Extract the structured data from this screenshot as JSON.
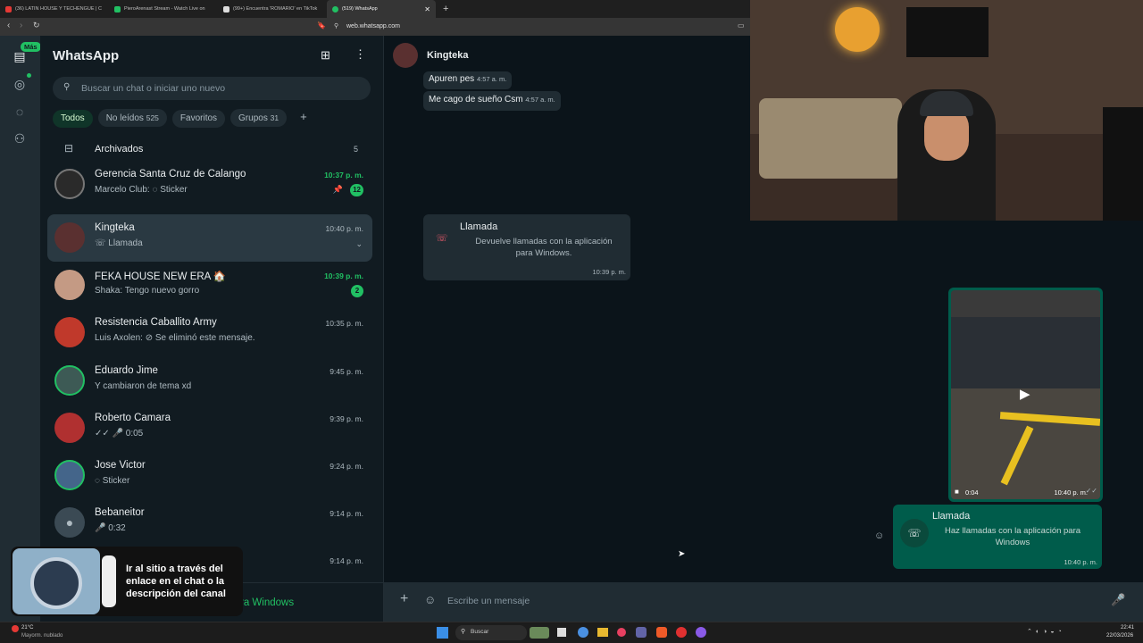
{
  "browser": {
    "tabs": [
      {
        "label": "(36) LATIN HOUSE Y TECHENGUE | C",
        "color": "#e53935"
      },
      {
        "label": "PieroArenast Stream - Watch Live on",
        "color": "#21c063"
      },
      {
        "label": "(99+) Encuentra 'ROMARIO' en TikTok",
        "color": "#ffffff"
      },
      {
        "label": "(519) WhatsApp",
        "color": "#21c063"
      }
    ],
    "url": "web.whatsapp.com"
  },
  "rail": {
    "mas_badge": "Más"
  },
  "sidebar": {
    "title": "WhatsApp",
    "search_placeholder": "Buscar un chat o iniciar uno nuevo",
    "filters": [
      {
        "label": "Todos",
        "count": ""
      },
      {
        "label": "No leídos",
        "count": "525"
      },
      {
        "label": "Favoritos",
        "count": ""
      },
      {
        "label": "Grupos",
        "count": "31"
      }
    ],
    "archived_label": "Archivados",
    "archived_count": "5",
    "chats": [
      {
        "name": "Gerencia Santa Cruz de Calango",
        "preview": "Marcelo Club: ◌ Sticker",
        "time": "10:37 p. m.",
        "badge": "12",
        "green": true,
        "avatar_color": "#2a2a2a"
      },
      {
        "name": "Kingteka",
        "preview": "☏ Llamada",
        "time": "10:40 p. m.",
        "badge": "",
        "green": false,
        "avatar_color": "#5a3030"
      },
      {
        "name": "FEKA HOUSE NEW ERA 🏠",
        "preview": "Shaka: Tengo nuevo gorro",
        "time": "10:39 p. m.",
        "badge": "2",
        "green": true,
        "avatar_color": "#c49a84"
      },
      {
        "name": "Resistencia Caballito Army",
        "preview": "Luis Axolen: ⊘ Se eliminó este mensaje.",
        "time": "10:35 p. m.",
        "badge": "",
        "green": false,
        "avatar_color": "#c0392b"
      },
      {
        "name": "Eduardo Jime",
        "preview": "Y cambiaron de tema xd",
        "time": "9:45 p. m.",
        "badge": "",
        "green": false,
        "avatar_color": "#3d5a55"
      },
      {
        "name": "Roberto Camara",
        "preview": "✓✓ 🎤 0:05",
        "time": "9:39 p. m.",
        "badge": "",
        "green": false,
        "avatar_color": "#b03030"
      },
      {
        "name": "Jose Victor",
        "preview": "◌ Sticker",
        "time": "9:24 p. m.",
        "badge": "",
        "green": false,
        "avatar_color": "#44658a"
      },
      {
        "name": "Bebaneitor",
        "preview": "🎤 0:32",
        "time": "9:14 p. m.",
        "badge": "",
        "green": false,
        "avatar_color": "#3b4a54"
      },
      {
        "name": "",
        "preview": "",
        "time": "9:14 p. m.",
        "badge": "",
        "green": false,
        "avatar_color": "#3b4a54"
      }
    ],
    "promo": "ra Windows"
  },
  "chat": {
    "contact_name": "Kingteka",
    "messages": [
      {
        "text": "Apuren pes",
        "time": "4:57 a. m."
      },
      {
        "text": "Me cago de sueño Csm",
        "time": "4:57 a. m."
      }
    ],
    "missed_call": {
      "title": "Llamada",
      "subtitle": "Devuelve llamadas con la aplicación para Windows.",
      "time": "10:39 p. m."
    },
    "video": {
      "duration": "0:04",
      "time": "10:40 p. m."
    },
    "out_call": {
      "title": "Llamada",
      "subtitle": "Haz llamadas con la aplicación para Windows",
      "time": "10:40 p. m."
    },
    "composer_placeholder": "Escribe un mensaje"
  },
  "overlay": {
    "text": "Ir al sitio a través del enlace en el chat o la descripción del canal"
  },
  "taskbar": {
    "weather_temp": "21°C",
    "weather_desc": "Mayorm. nublado",
    "search": "Buscar",
    "time": "22:41",
    "date": "22/03/2026"
  }
}
